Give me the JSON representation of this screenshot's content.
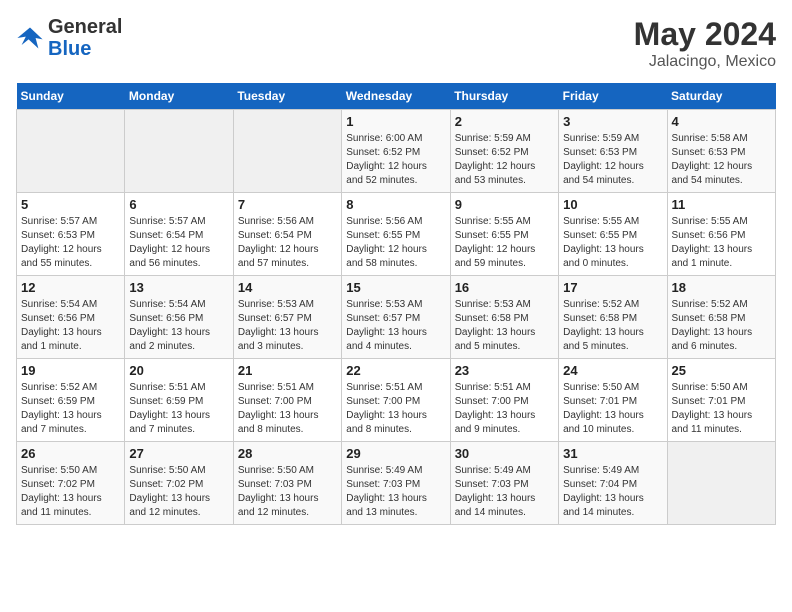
{
  "header": {
    "logo_line1": "General",
    "logo_line2": "Blue",
    "month_year": "May 2024",
    "location": "Jalacingo, Mexico"
  },
  "days_of_week": [
    "Sunday",
    "Monday",
    "Tuesday",
    "Wednesday",
    "Thursday",
    "Friday",
    "Saturday"
  ],
  "weeks": [
    [
      {
        "day": "",
        "info": ""
      },
      {
        "day": "",
        "info": ""
      },
      {
        "day": "",
        "info": ""
      },
      {
        "day": "1",
        "info": "Sunrise: 6:00 AM\nSunset: 6:52 PM\nDaylight: 12 hours\nand 52 minutes."
      },
      {
        "day": "2",
        "info": "Sunrise: 5:59 AM\nSunset: 6:52 PM\nDaylight: 12 hours\nand 53 minutes."
      },
      {
        "day": "3",
        "info": "Sunrise: 5:59 AM\nSunset: 6:53 PM\nDaylight: 12 hours\nand 54 minutes."
      },
      {
        "day": "4",
        "info": "Sunrise: 5:58 AM\nSunset: 6:53 PM\nDaylight: 12 hours\nand 54 minutes."
      }
    ],
    [
      {
        "day": "5",
        "info": "Sunrise: 5:57 AM\nSunset: 6:53 PM\nDaylight: 12 hours\nand 55 minutes."
      },
      {
        "day": "6",
        "info": "Sunrise: 5:57 AM\nSunset: 6:54 PM\nDaylight: 12 hours\nand 56 minutes."
      },
      {
        "day": "7",
        "info": "Sunrise: 5:56 AM\nSunset: 6:54 PM\nDaylight: 12 hours\nand 57 minutes."
      },
      {
        "day": "8",
        "info": "Sunrise: 5:56 AM\nSunset: 6:55 PM\nDaylight: 12 hours\nand 58 minutes."
      },
      {
        "day": "9",
        "info": "Sunrise: 5:55 AM\nSunset: 6:55 PM\nDaylight: 12 hours\nand 59 minutes."
      },
      {
        "day": "10",
        "info": "Sunrise: 5:55 AM\nSunset: 6:55 PM\nDaylight: 13 hours\nand 0 minutes."
      },
      {
        "day": "11",
        "info": "Sunrise: 5:55 AM\nSunset: 6:56 PM\nDaylight: 13 hours\nand 1 minute."
      }
    ],
    [
      {
        "day": "12",
        "info": "Sunrise: 5:54 AM\nSunset: 6:56 PM\nDaylight: 13 hours\nand 1 minute."
      },
      {
        "day": "13",
        "info": "Sunrise: 5:54 AM\nSunset: 6:56 PM\nDaylight: 13 hours\nand 2 minutes."
      },
      {
        "day": "14",
        "info": "Sunrise: 5:53 AM\nSunset: 6:57 PM\nDaylight: 13 hours\nand 3 minutes."
      },
      {
        "day": "15",
        "info": "Sunrise: 5:53 AM\nSunset: 6:57 PM\nDaylight: 13 hours\nand 4 minutes."
      },
      {
        "day": "16",
        "info": "Sunrise: 5:53 AM\nSunset: 6:58 PM\nDaylight: 13 hours\nand 5 minutes."
      },
      {
        "day": "17",
        "info": "Sunrise: 5:52 AM\nSunset: 6:58 PM\nDaylight: 13 hours\nand 5 minutes."
      },
      {
        "day": "18",
        "info": "Sunrise: 5:52 AM\nSunset: 6:58 PM\nDaylight: 13 hours\nand 6 minutes."
      }
    ],
    [
      {
        "day": "19",
        "info": "Sunrise: 5:52 AM\nSunset: 6:59 PM\nDaylight: 13 hours\nand 7 minutes."
      },
      {
        "day": "20",
        "info": "Sunrise: 5:51 AM\nSunset: 6:59 PM\nDaylight: 13 hours\nand 7 minutes."
      },
      {
        "day": "21",
        "info": "Sunrise: 5:51 AM\nSunset: 7:00 PM\nDaylight: 13 hours\nand 8 minutes."
      },
      {
        "day": "22",
        "info": "Sunrise: 5:51 AM\nSunset: 7:00 PM\nDaylight: 13 hours\nand 8 minutes."
      },
      {
        "day": "23",
        "info": "Sunrise: 5:51 AM\nSunset: 7:00 PM\nDaylight: 13 hours\nand 9 minutes."
      },
      {
        "day": "24",
        "info": "Sunrise: 5:50 AM\nSunset: 7:01 PM\nDaylight: 13 hours\nand 10 minutes."
      },
      {
        "day": "25",
        "info": "Sunrise: 5:50 AM\nSunset: 7:01 PM\nDaylight: 13 hours\nand 11 minutes."
      }
    ],
    [
      {
        "day": "26",
        "info": "Sunrise: 5:50 AM\nSunset: 7:02 PM\nDaylight: 13 hours\nand 11 minutes."
      },
      {
        "day": "27",
        "info": "Sunrise: 5:50 AM\nSunset: 7:02 PM\nDaylight: 13 hours\nand 12 minutes."
      },
      {
        "day": "28",
        "info": "Sunrise: 5:50 AM\nSunset: 7:03 PM\nDaylight: 13 hours\nand 12 minutes."
      },
      {
        "day": "29",
        "info": "Sunrise: 5:49 AM\nSunset: 7:03 PM\nDaylight: 13 hours\nand 13 minutes."
      },
      {
        "day": "30",
        "info": "Sunrise: 5:49 AM\nSunset: 7:03 PM\nDaylight: 13 hours\nand 14 minutes."
      },
      {
        "day": "31",
        "info": "Sunrise: 5:49 AM\nSunset: 7:04 PM\nDaylight: 13 hours\nand 14 minutes."
      },
      {
        "day": "",
        "info": ""
      }
    ]
  ]
}
